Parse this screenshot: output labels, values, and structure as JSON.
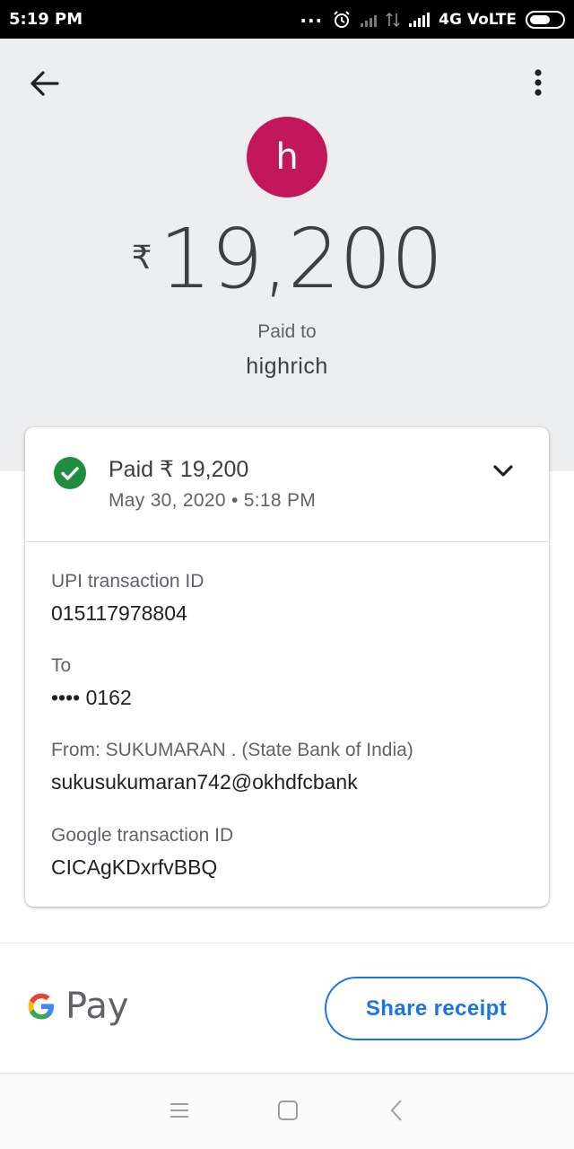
{
  "status_bar": {
    "time": "5:19 PM",
    "network": "4G VoLTE",
    "icons": [
      "more-dots-icon",
      "alarm-icon",
      "signal-icon",
      "data-arrows-icon",
      "battery-icon"
    ]
  },
  "header": {
    "back_icon": "arrow-back-icon",
    "menu_icon": "more-vert-icon",
    "avatar_letter": "h",
    "avatar_color": "#c2185b",
    "currency_symbol": "₹",
    "amount": "19,200",
    "paid_to_label": "Paid to",
    "payee_name": "highrich"
  },
  "transaction": {
    "status_icon": "check-circle-icon",
    "status_color": "#1e8e3e",
    "status_text": "Paid ₹ 19,200",
    "datetime": "May 30, 2020 • 5:18 PM",
    "expand_icon": "chevron-down-icon",
    "details": [
      {
        "label": "UPI transaction ID",
        "value": "015117978804"
      },
      {
        "label": "To",
        "value": "•••• 0162"
      },
      {
        "label": "From: SUKUMARAN  . (State Bank of India)",
        "value": "sukusukumaran742@okhdfcbank"
      },
      {
        "label": "Google transaction ID",
        "value": "CICAgKDxrfvBBQ"
      }
    ]
  },
  "footer": {
    "brand_text": "Pay",
    "share_label": "Share receipt",
    "accent_color": "#1a73e8"
  },
  "nav_bar": {
    "icons": [
      "menu-icon",
      "home-square-icon",
      "back-chevron-icon"
    ]
  }
}
